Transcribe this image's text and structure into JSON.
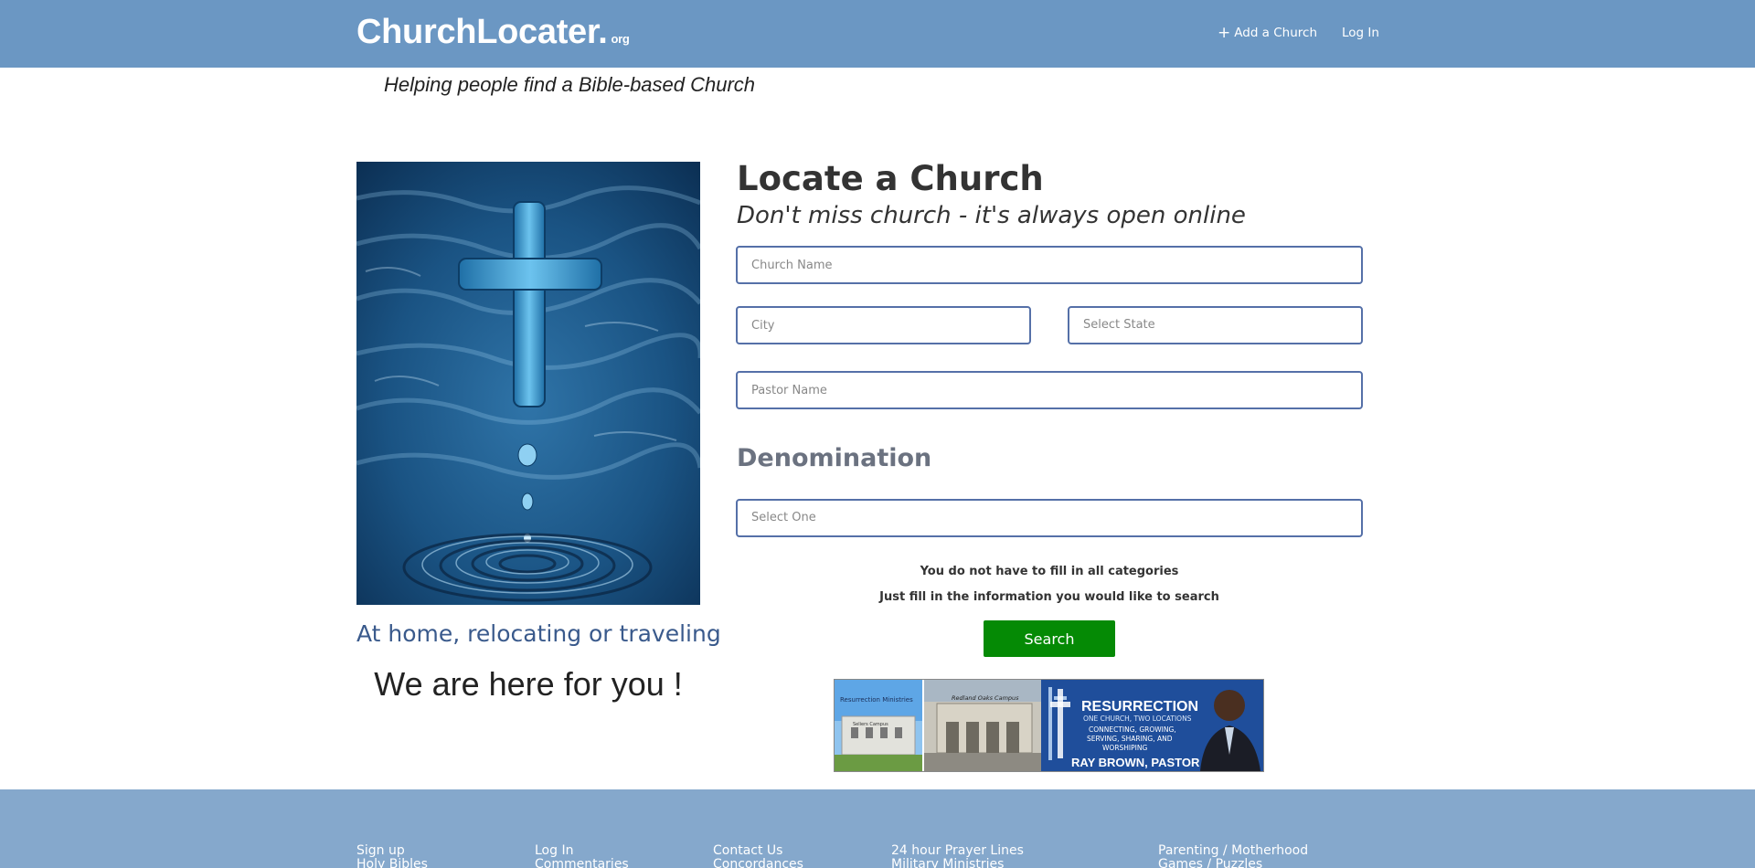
{
  "header": {
    "logo": "ChurchLocater.",
    "logo_tld": "org",
    "add_church": "Add a Church",
    "login": "Log In"
  },
  "tagline": "Helping people find a Bible-based Church",
  "left": {
    "subtitle": "At home, relocating or traveling",
    "big_text": "We are here for you !"
  },
  "form": {
    "title": "Locate a Church",
    "subtitle": "Don't miss church - it's always open online",
    "church_name_placeholder": "Church Name",
    "city_placeholder": "City",
    "state_select": "Select State",
    "pastor_placeholder": "Pastor Name",
    "denomination_label": "Denomination",
    "denomination_select": "Select One",
    "note1": "You do not have to fill in all categories",
    "note2": "Just fill in the information you would like to search",
    "search_button": "Search"
  },
  "banner": {
    "campus1": "Resurrection Ministries",
    "campus1_sub": "Seliers Campus",
    "campus2": "Redland Oaks Campus",
    "title": "RESURRECTION",
    "line1": "ONE CHURCH, TWO LOCATIONS",
    "line2": "CONNECTING, GROWING,",
    "line3": "SERVING, SHARING, AND",
    "line4": "WORSHIPING",
    "pastor": "RAY BROWN, PASTOR"
  },
  "footer": {
    "col1": [
      "Sign up",
      "Holy Bibles"
    ],
    "col2": [
      "Log In",
      "Commentaries"
    ],
    "col3": [
      "Contact Us",
      "Concordances"
    ],
    "col4": [
      "24 hour Prayer Lines",
      "Military Ministries"
    ],
    "col5": [
      "Parenting / Motherhood",
      "Games / Puzzles"
    ]
  }
}
